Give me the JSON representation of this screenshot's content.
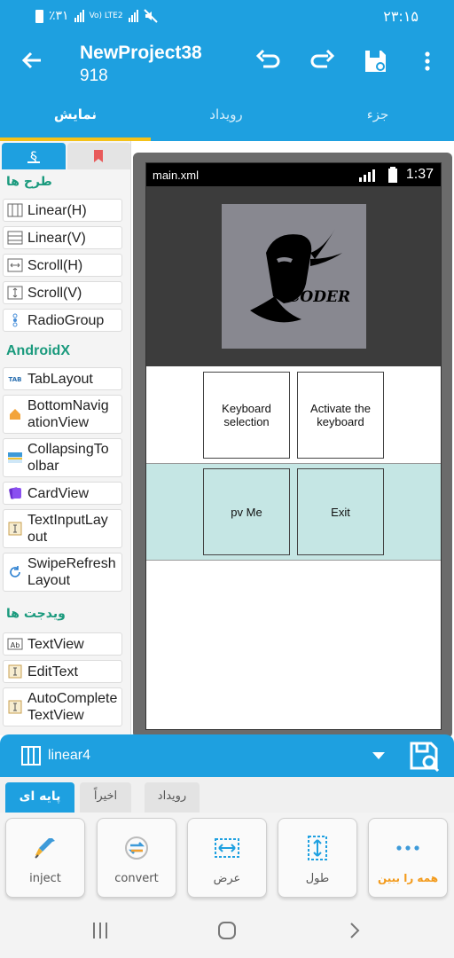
{
  "status_bar": {
    "time": "۲۳:۱۵",
    "carrier": "٪۳۱",
    "network": "Vo) LTE2"
  },
  "app_bar": {
    "title": "NewProject38",
    "subtitle": "918"
  },
  "tabs": [
    {
      "label": "نمایش",
      "active": true
    },
    {
      "label": "رویداد",
      "active": false
    },
    {
      "label": "جزء",
      "active": false
    }
  ],
  "palette": {
    "sections": {
      "layouts": "طرح ها",
      "androidx": "AndroidX",
      "widgets": "ویدجت ها"
    },
    "layouts": [
      {
        "label": "Linear(H)",
        "icon": "linear-h-icon"
      },
      {
        "label": "Linear(V)",
        "icon": "linear-v-icon"
      },
      {
        "label": "Scroll(H)",
        "icon": "scroll-h-icon"
      },
      {
        "label": "Scroll(V)",
        "icon": "scroll-v-icon"
      },
      {
        "label": "RadioGroup",
        "icon": "radiogroup-icon"
      }
    ],
    "androidx": [
      {
        "label": "TabLayout",
        "icon": "tab-icon"
      },
      {
        "label": "BottomNavigationView",
        "line1": "BottomNavig",
        "line2": "ationView",
        "icon": "home-icon"
      },
      {
        "label": "CollapsingToolbar",
        "line1": "CollapsingTo",
        "line2": "olbar",
        "icon": "toolbar-icon"
      },
      {
        "label": "CardView",
        "icon": "card-icon"
      },
      {
        "label": "TextInputLayout",
        "line1": "TextInputLay",
        "line2": "out",
        "icon": "textinput-icon"
      },
      {
        "label": "SwipeRefreshLayout",
        "line1": "SwipeRefresh",
        "line2": "Layout",
        "icon": "refresh-icon"
      }
    ],
    "widgets": [
      {
        "label": "TextView",
        "icon": "textview-icon"
      },
      {
        "label": "EditText",
        "icon": "edittext-icon"
      },
      {
        "label": "AutoCompleteTextView",
        "line1": "AutoComplete",
        "line2": "TextView",
        "icon": "autocomplete-icon"
      }
    ]
  },
  "preview": {
    "filename": "main.xml",
    "time": "1:37",
    "logo_text": "CODER",
    "buttons": [
      {
        "label": "Keyboard selection",
        "line1": "Keyboard",
        "line2": "selection"
      },
      {
        "label": "Activate the keyboard",
        "line1": "Activate the",
        "line2": "keyboard"
      },
      {
        "label": "pv Me"
      },
      {
        "label": "Exit"
      }
    ]
  },
  "properties": {
    "selected": "linear4",
    "tabs": [
      {
        "label": "پایه ای",
        "active": true
      },
      {
        "label": "اخیراً",
        "active": false
      },
      {
        "label": "رویداد",
        "active": false
      }
    ],
    "actions": [
      {
        "label": "inject",
        "icon": "syringe-icon"
      },
      {
        "label": "convert",
        "icon": "convert-icon"
      },
      {
        "label": "عرض",
        "icon": "width-icon"
      },
      {
        "label": "طول",
        "icon": "height-icon"
      },
      {
        "label": "همه را ببین",
        "icon": "more-dots-icon"
      }
    ]
  },
  "colors": {
    "primary": "#1ea0e0",
    "accent": "#f4c21a",
    "section": "#1a9a7d",
    "teal_row": "#c5e6e4",
    "orange": "#f39a1a"
  }
}
